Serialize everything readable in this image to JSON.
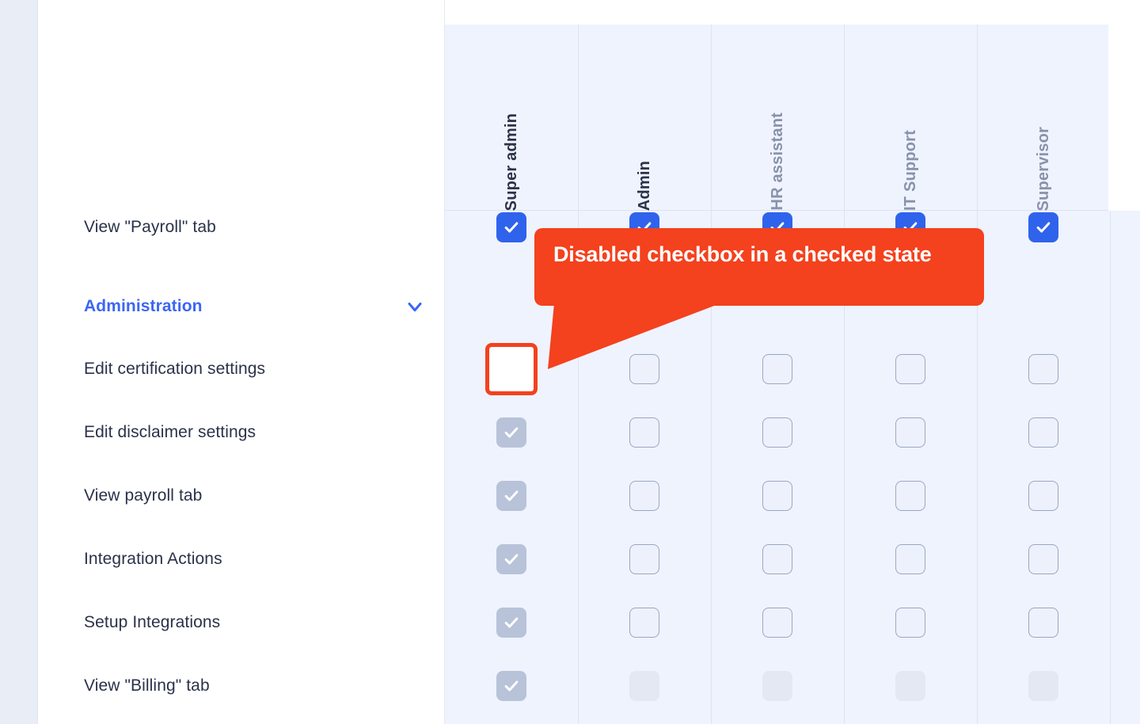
{
  "columns": [
    {
      "label": "Super admin",
      "tone": "dark"
    },
    {
      "label": "Admin",
      "tone": "dark"
    },
    {
      "label": "HR assistant",
      "tone": "muted"
    },
    {
      "label": "IT Support",
      "tone": "muted"
    },
    {
      "label": "Supervisor",
      "tone": "muted"
    }
  ],
  "rows": [
    {
      "type": "permission",
      "label": "View \"Payroll\" tab",
      "states": [
        "checked-on",
        "checked-on",
        "checked-on",
        "checked-on",
        "checked-on"
      ]
    },
    {
      "type": "group",
      "label": "Administration",
      "icon": "chevron-down-icon"
    },
    {
      "type": "permission",
      "label": "Edit certification settings",
      "states": [
        "disabled-on",
        "unchecked",
        "unchecked",
        "unchecked",
        "unchecked"
      ],
      "highlight": true
    },
    {
      "type": "permission",
      "label": "Edit disclaimer settings",
      "states": [
        "disabled-on",
        "unchecked",
        "unchecked",
        "unchecked",
        "unchecked"
      ]
    },
    {
      "type": "permission",
      "label": "View payroll tab",
      "states": [
        "disabled-on",
        "unchecked",
        "unchecked",
        "unchecked",
        "unchecked"
      ]
    },
    {
      "type": "permission",
      "label": "Integration Actions",
      "states": [
        "disabled-on",
        "unchecked",
        "unchecked",
        "unchecked",
        "unchecked"
      ]
    },
    {
      "type": "permission",
      "label": "Setup Integrations",
      "states": [
        "disabled-on",
        "unchecked",
        "unchecked",
        "unchecked",
        "unchecked"
      ]
    },
    {
      "type": "permission",
      "label": "View \"Billing\" tab",
      "states": [
        "disabled-on",
        "disabled-off",
        "disabled-off",
        "disabled-off",
        "disabled-off"
      ]
    }
  ],
  "callout": {
    "text": "Disabled checkbox in a checked state",
    "color": "#f4411e",
    "text_color": "#ffffff"
  },
  "colors": {
    "accent_blue": "#3b66f5",
    "checkbox_checked": "#2f63ec",
    "checkbox_disabled_checked": "#b8c2d9",
    "matrix_background": "#eff3fd",
    "grid_line": "#dbe3f5",
    "label_text": "#2b3249",
    "muted_header": "#8892ab",
    "callout": "#f4411e"
  }
}
